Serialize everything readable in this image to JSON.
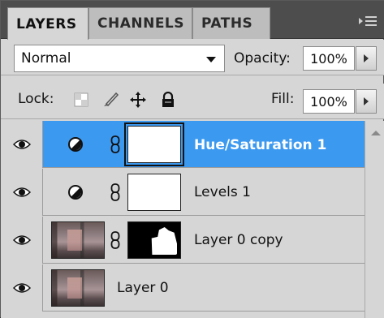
{
  "tabs": [
    {
      "label": "LAYERS",
      "active": true
    },
    {
      "label": "CHANNELS",
      "active": false
    },
    {
      "label": "PATHS",
      "active": false
    }
  ],
  "blend_mode": {
    "value": "Normal"
  },
  "opacity": {
    "label": "Opacity:",
    "value": "100%"
  },
  "lock": {
    "label": "Lock:"
  },
  "fill": {
    "label": "Fill:",
    "value": "100%"
  },
  "layers": [
    {
      "name": "Hue/Saturation 1",
      "selected": true,
      "thumb": "adjustment-mask"
    },
    {
      "name": "Levels 1",
      "selected": false,
      "thumb": "adjustment-mask"
    },
    {
      "name": "Layer 0 copy",
      "selected": false,
      "thumb": "photo-with-mask"
    },
    {
      "name": "Layer 0",
      "selected": false,
      "thumb": "photo"
    }
  ],
  "colors": {
    "selection": "#3c99f0",
    "panel": "#d6d6d6",
    "tabbar": "#4d4d4d"
  }
}
